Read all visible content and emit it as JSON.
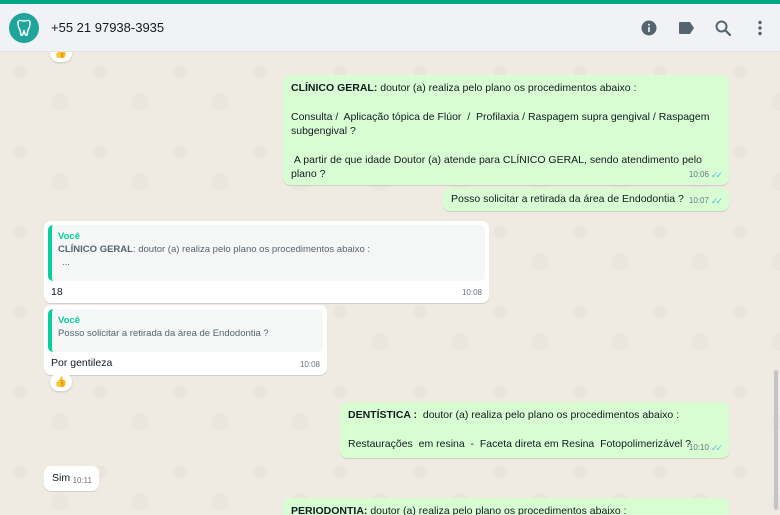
{
  "header": {
    "contact": "+55 21 97938-3935",
    "icons": [
      "info-icon",
      "label-icon",
      "search-icon",
      "menu-icon"
    ]
  },
  "messages": {
    "m1": {
      "bold": "CLÍNICO GERAL:",
      "text1": " doutor (a) realiza pelo plano os procedimentos abaixo :",
      "text2": "Consulta /  Aplicação tópica de Flúor  /  Profilaxia / Raspagem supra gengival / Raspagem subgengival ?",
      "text3": " A partir de que idade Doutor (a) atende para CLÍNICO GERAL, sendo atendimento pelo plano ?",
      "time": "10:06"
    },
    "m2": {
      "text": "Posso solicitar a retirada da área de  Endodontia ?",
      "time": "10:07"
    },
    "m3": {
      "quote_author": "Você",
      "quote_bold": "CLÍNICO GERAL",
      "quote_text": ":  doutor (a) realiza pelo plano os procedimentos abaixo :",
      "quote_more": "...",
      "text": "18",
      "time": "10:08"
    },
    "m4": {
      "quote_author": "Você",
      "quote_text": "Posso solicitar a retirada da área de  Endodontia ?",
      "text": "Por gentileza",
      "time": "10:08"
    },
    "m5": {
      "bold": "DENTÍSTICA :",
      "text1": "  doutor (a) realiza pelo plano os procedimentos abaixo :",
      "text2": "Restaurações  em resina  -  Faceta direta em Resina  Fotopolimerizável ?",
      "time": "10:10"
    },
    "m6": {
      "text": "Sim",
      "time": "10:11"
    },
    "m7": {
      "bold": "PERIODONTIA:",
      "text1": " doutor (a) realiza pelo plano os procedimentos abaixo :"
    }
  },
  "reactions": {
    "emoji": "👍"
  },
  "colors": {
    "accent": "#00a884",
    "outgoing": "#d9fdd3",
    "incoming": "#ffffff",
    "read_ticks": "#53bdeb",
    "quote_bar": "#06cf9c"
  }
}
